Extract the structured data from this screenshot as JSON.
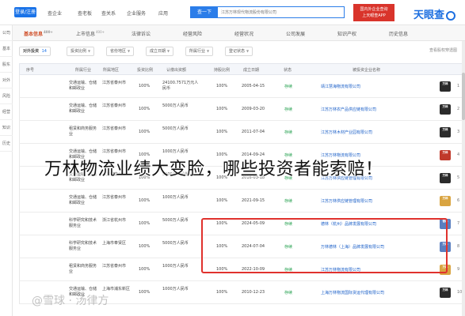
{
  "topbar": {
    "vip_label": "登录/注册",
    "nav": [
      "查企业",
      "查老板",
      "查关系",
      "企业服务",
      "应用",
      "天眼风险"
    ],
    "search_scope": "查一下",
    "search_value": "江苏万林现代物流股份有限公司",
    "ad_text_1": "国内外企业查询",
    "ad_text_2": "上天眼查APP",
    "logo_text": "天眼查"
  },
  "rail": [
    "公司",
    "基本",
    "股东",
    "对外",
    "风险",
    "经营",
    "知识",
    "历史"
  ],
  "tabs": [
    {
      "label": "基本信息",
      "count": "400+",
      "active": true
    },
    {
      "label": "上市信息",
      "count": "400+",
      "active": false
    },
    {
      "label": "法律诉讼",
      "count": "",
      "active": false
    },
    {
      "label": "经营风险",
      "count": "",
      "active": false
    },
    {
      "label": "经营状况",
      "count": "",
      "active": false
    },
    {
      "label": "公司发展",
      "count": "",
      "active": false
    },
    {
      "label": "知识产权",
      "count": "",
      "active": false
    },
    {
      "label": "历史信息",
      "count": "",
      "active": false
    }
  ],
  "section": {
    "title": "对外投资",
    "count": "14",
    "link": "查看股权穿透图"
  },
  "filters": [
    "投资比例",
    "省份地区",
    "成立日期",
    "所属行业",
    "登记状态",
    "筛选条件"
  ],
  "headers": [
    "序号",
    "被投资企业名称",
    "状态",
    "成立日期",
    "持股比例",
    "认缴出资额",
    "投资比例",
    "所属地区",
    "所属行业"
  ],
  "rows": [
    {
      "idx": "1",
      "logo": "万林",
      "logo_color": "#2b2b2b",
      "name": "靖江慧海物流有限公司",
      "status": "存续",
      "date": "2005-04-15",
      "ratio": "100%",
      "capital": "24100.7571万元人民币",
      "ratio2": "100%",
      "region": "江苏省泰州市",
      "industry": "交通运输、仓储和邮政业"
    },
    {
      "idx": "2",
      "logo": "万林",
      "logo_color": "#2b2b2b",
      "name": "江苏万林农产品供应链有限公司",
      "status": "存续",
      "date": "2009-03-20",
      "ratio": "100%",
      "capital": "5000万人民币",
      "ratio2": "100%",
      "region": "江苏省泰州市",
      "industry": "交通运输、仓储和邮政业"
    },
    {
      "idx": "3",
      "logo": "万林",
      "logo_color": "#2b2b2b",
      "name": "江苏万林木材产业园有限公司",
      "status": "存续",
      "date": "2011-07-04",
      "ratio": "100%",
      "capital": "5000万人民币",
      "ratio2": "100%",
      "region": "江苏省泰州市",
      "industry": "租赁和商务服务业"
    },
    {
      "idx": "4",
      "logo": "万林",
      "logo_color": "#c0392b",
      "name": "江苏万林物流有限公司",
      "status": "存续",
      "date": "2014-09-24",
      "ratio": "100%",
      "capital": "1000万人民币",
      "ratio2": "100%",
      "region": "江苏省泰州市",
      "industry": "交通运输、仓储和邮政业"
    },
    {
      "idx": "5",
      "logo": "万林",
      "logo_color": "#2b2b2b",
      "name": "江苏万林供应链管理有限公司",
      "status": "存续",
      "date": "2016-03-18",
      "ratio": "100%",
      "capital": "5000万人民币",
      "ratio2": "100%",
      "region": "江苏省泰州市",
      "industry": "交通运输、仓储和邮政业"
    },
    {
      "idx": "6",
      "logo": "万林",
      "logo_color": "#d9a441",
      "name": "江苏万林供应链管理有限公司",
      "status": "存续",
      "date": "2021-09-15",
      "ratio": "100%",
      "capital": "1000万人民币",
      "ratio2": "100%",
      "region": "江苏省泰州市",
      "industry": "交通运输、仓储和邮政业"
    },
    {
      "idx": "7",
      "logo": "德林",
      "logo_color": "#5a7fc0",
      "name": "德林（杭州）品牌发展有限公司",
      "status": "存续",
      "date": "2024-05-09",
      "ratio": "100%",
      "capital": "5000万人民币",
      "ratio2": "100%",
      "region": "浙江省杭州市",
      "industry": "科学研究和技术服务业"
    },
    {
      "idx": "8",
      "logo": "万林",
      "logo_color": "#5a7fc0",
      "name": "万林德林（上海）品牌发展有限公司",
      "status": "存续",
      "date": "2024-07-04",
      "ratio": "100%",
      "capital": "5000万人民币",
      "ratio2": "100%",
      "region": "上海市奉贤区",
      "industry": "科学研究和技术服务业"
    },
    {
      "idx": "9",
      "logo": "万林",
      "logo_color": "#d9a441",
      "name": "江苏万林物流有限公司",
      "status": "存续",
      "date": "2022-10-09",
      "ratio": "100%",
      "capital": "1000万人民币",
      "ratio2": "100%",
      "region": "江苏省泰州市",
      "industry": "租赁和商务服务业"
    },
    {
      "idx": "10",
      "logo": "万林",
      "logo_color": "#2b2b2b",
      "name": "上海万林物流国际货运代理有限公司",
      "status": "存续",
      "date": "2010-12-23",
      "ratio": "100%",
      "capital": "1000万人民币",
      "ratio2": "100%",
      "region": "上海市浦东新区",
      "industry": "交通运输、仓储和邮政业"
    }
  ],
  "overlay_title": "万林物流业绩大变脸，哪些投资者能索赔！",
  "watermark": "@雪球 · 汤律方"
}
